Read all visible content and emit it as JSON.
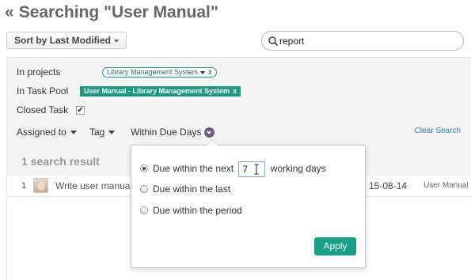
{
  "page": {
    "back_glyph": "«",
    "title": "Searching \"User Manual\""
  },
  "toolbar": {
    "sort_label": "Sort by Last Modified",
    "search_value": "report"
  },
  "filters": {
    "projects_label": "In projects",
    "projects_tag": "Library Management System",
    "task_pool_label": "In Task Pool",
    "task_pool_tag": "User Manual - Library Management System",
    "tag_remove": "x",
    "closed_task_label": "Closed Task",
    "closed_task_checked": true,
    "check_glyph": "✔",
    "assigned_to": "Assigned to",
    "tag": "Tag",
    "within_due_days": "Within Due Days",
    "clear_search": "Clear Search"
  },
  "results": {
    "count_label": "1 search result",
    "rows": [
      {
        "num": "1",
        "name": "Write user manual",
        "date": "15-08-14",
        "project": "User Manual"
      }
    ]
  },
  "popup": {
    "opt1_prefix": "Due within the next",
    "days_value": "7",
    "opt1_suffix": "working days",
    "opt2": "Due within the last",
    "opt3": "Due within the period",
    "apply": "Apply"
  },
  "colors": {
    "accent": "#16a085",
    "link": "#2d7dbf",
    "due_circle": "#6a5c8c"
  }
}
